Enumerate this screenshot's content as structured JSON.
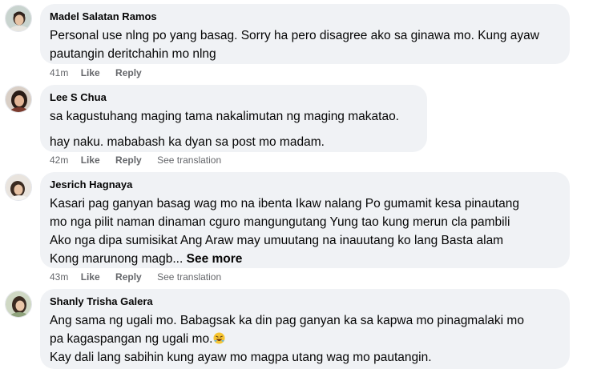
{
  "comments": [
    {
      "author": "Madel Salatan Ramos",
      "lines": [
        "Personal use nlng po yang basag. Sorry ha pero disagree ako sa ginawa mo. Kung ayaw",
        "pautangin deritchahin mo nlng"
      ],
      "time": "41m",
      "like": "Like",
      "reply": "Reply"
    },
    {
      "author": "Lee S Chua",
      "para1": "sa kagustuhang maging tama nakalimutan ng maging makatao.",
      "para2": "hay naku. mababash ka dyan sa post mo madam.",
      "time": "42m",
      "like": "Like",
      "reply": "Reply",
      "translation": "See translation"
    },
    {
      "author": "Jesrich Hagnaya",
      "lines": [
        "Kasari pag ganyan basag wag mo na ibenta Ikaw nalang Po gumamit kesa pinautang",
        "mo nga pilit naman dinaman cguro mangungutang Yung tao kung merun cla pambili",
        "Ako nga dipa sumisikat Ang Araw may umuutang na inauutang ko lang Basta alam",
        "Kong marunong magb..."
      ],
      "see_more": "See more",
      "time": "43m",
      "like": "Like",
      "reply": "Reply",
      "translation": "See translation"
    },
    {
      "author": "Shanly Trisha Galera",
      "lines": [
        "Ang sama ng ugali mo. Babagsak ka din pag ganyan ka sa kapwa mo pinagmalaki mo",
        "pa kagaspangan ng ugali mo.",
        "Kay dali lang sabihin kung ayaw mo magpa utang wag mo pautangin."
      ],
      "emoji": "rolling-on-floor-laughing-emoji"
    }
  ],
  "colors": {
    "bubble": "#f0f2f5",
    "text": "#050505",
    "meta": "#65676b"
  }
}
